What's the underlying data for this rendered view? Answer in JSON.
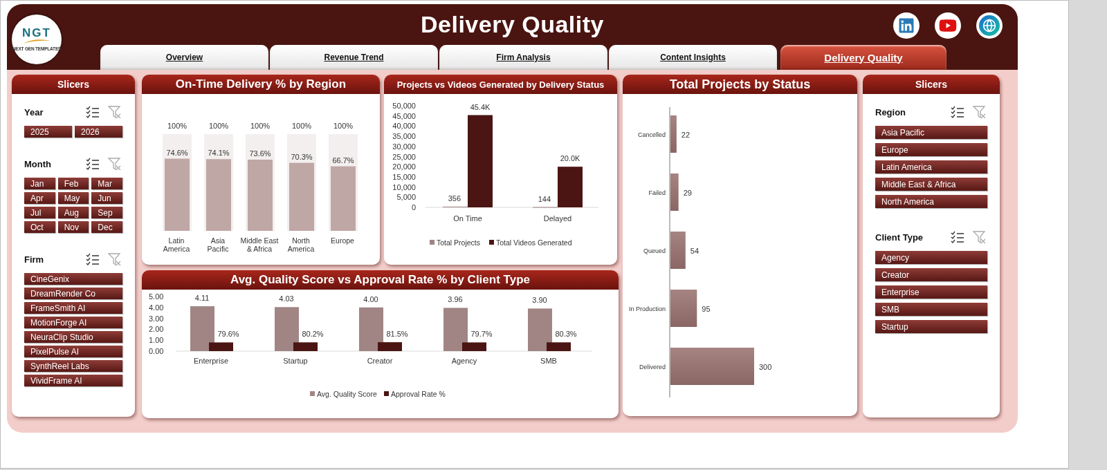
{
  "logo": {
    "text": "NGT",
    "tagline": "NEXT GEN TEMPLATES"
  },
  "title": "Delivery Quality",
  "tabs": [
    {
      "label": "Overview",
      "selected": false
    },
    {
      "label": "Revenue Trend",
      "selected": false
    },
    {
      "label": "Firm Analysis",
      "selected": false
    },
    {
      "label": "Content Insights",
      "selected": false
    },
    {
      "label": "Delivery Quality",
      "selected": true
    }
  ],
  "left_slicers": {
    "title": "Slicers",
    "groups": [
      {
        "title": "Year",
        "items": [
          {
            "label": "2025",
            "selected": true
          },
          {
            "label": "2026",
            "selected": true
          }
        ]
      },
      {
        "title": "Month",
        "items": [
          {
            "label": "Jan",
            "selected": true
          },
          {
            "label": "Feb",
            "selected": true
          },
          {
            "label": "Mar",
            "selected": true
          },
          {
            "label": "Apr",
            "selected": true
          },
          {
            "label": "May",
            "selected": true
          },
          {
            "label": "Jun",
            "selected": true
          },
          {
            "label": "Jul",
            "selected": true
          },
          {
            "label": "Aug",
            "selected": true
          },
          {
            "label": "Sep",
            "selected": true
          },
          {
            "label": "Oct",
            "selected": true
          },
          {
            "label": "Nov",
            "selected": true
          },
          {
            "label": "Dec",
            "selected": true
          }
        ]
      },
      {
        "title": "Firm",
        "items": [
          {
            "label": "CineGenix",
            "selected": true
          },
          {
            "label": "DreamRender Co",
            "selected": true
          },
          {
            "label": "FrameSmith AI",
            "selected": true
          },
          {
            "label": "MotionForge AI",
            "selected": true
          },
          {
            "label": "NeuraClip Studio",
            "selected": true
          },
          {
            "label": "PixelPulse AI",
            "selected": true
          },
          {
            "label": "SynthReel Labs",
            "selected": true
          },
          {
            "label": "VividFrame AI",
            "selected": true
          }
        ]
      }
    ]
  },
  "ontime_chart": {
    "title": "On-Time Delivery % by Region",
    "chart_data": {
      "type": "bar",
      "categories": [
        "Latin America",
        "Asia Pacific",
        "Middle East & Africa",
        "North America",
        "Europe"
      ],
      "series": [
        {
          "color": "#f3efee",
          "values": [
            100,
            100,
            100,
            100,
            100
          ],
          "value_labels": [
            "100%",
            "100%",
            "100%",
            "100%",
            "100%"
          ]
        },
        {
          "color": "#bfa7a6",
          "values": [
            74.6,
            74.1,
            73.6,
            70.3,
            66.7
          ],
          "value_labels": [
            "74.6%",
            "74.1%",
            "73.6%",
            "70.3%",
            "66.7%"
          ]
        }
      ]
    }
  },
  "videos_chart": {
    "title": "Projects vs Videos Generated by Delivery Status",
    "chart_data": {
      "type": "bar",
      "categories": [
        "On Time",
        "Delayed"
      ],
      "series": [
        {
          "name": "Total Projects",
          "color": "#a08584",
          "values": [
            356,
            144
          ],
          "value_labels": [
            "356",
            "144"
          ]
        },
        {
          "name": "Total Videos Generated",
          "color": "#4a1512",
          "values": [
            45400,
            20000
          ],
          "value_labels": [
            "45.4K",
            "20.0K"
          ]
        }
      ],
      "legend": "bottom",
      "ylim": [
        0,
        50000
      ],
      "yticks": [
        {
          "value": 0,
          "label": "0"
        },
        {
          "value": 5000,
          "label": "5,000"
        },
        {
          "value": 10000,
          "label": "10,000"
        },
        {
          "value": 15000,
          "label": "15,000"
        },
        {
          "value": 20000,
          "label": "20,000"
        },
        {
          "value": 25000,
          "label": "25,000"
        },
        {
          "value": 30000,
          "label": "30,000"
        },
        {
          "value": 35000,
          "label": "35,000"
        },
        {
          "value": 40000,
          "label": "40,000"
        },
        {
          "value": 45000,
          "label": "45,000"
        },
        {
          "value": 50000,
          "label": "50,000"
        }
      ]
    }
  },
  "quality_chart": {
    "title": "Avg. Quality Score vs Approval Rate % by Client Type",
    "chart_data": {
      "type": "bar",
      "categories": [
        "Enterprise",
        "Startup",
        "Creator",
        "Agency",
        "SMB"
      ],
      "series": [
        {
          "name": "Avg. Quality Score",
          "color": "#a08584",
          "values": [
            4.11,
            4.03,
            4.0,
            3.96,
            3.9
          ],
          "value_labels": [
            "4.11",
            "4.03",
            "4.00",
            "3.96",
            "3.90"
          ]
        },
        {
          "name": "Approval Rate %",
          "color": "#4a1512",
          "values": [
            0.796,
            0.802,
            0.815,
            0.797,
            0.803
          ],
          "value_labels": [
            "79.6%",
            "80.2%",
            "81.5%",
            "79.7%",
            "80.3%"
          ]
        }
      ],
      "legend": "bottom",
      "ylim": [
        0,
        5
      ],
      "yticks": [
        {
          "value": 0,
          "label": "0.00"
        },
        {
          "value": 1,
          "label": "1.00"
        },
        {
          "value": 2,
          "label": "2.00"
        },
        {
          "value": 3,
          "label": "3.00"
        },
        {
          "value": 4,
          "label": "4.00"
        },
        {
          "value": 5,
          "label": "5.00"
        }
      ]
    }
  },
  "status_chart": {
    "title": "Total Projects by Status",
    "chart_data": {
      "type": "bar",
      "orientation": "horizontal",
      "categories": [
        "Cancelled",
        "Failed",
        "Queued",
        "In Production",
        "Delivered"
      ],
      "series": [
        {
          "color": "#8a6664",
          "values": [
            22,
            29,
            54,
            95,
            300
          ],
          "value_labels": [
            "22",
            "29",
            "54",
            "95",
            "300"
          ]
        }
      ]
    }
  },
  "right_slicers": {
    "title": "Slicers",
    "groups": [
      {
        "title": "Region",
        "items": [
          {
            "label": "Asia Pacific",
            "selected": true
          },
          {
            "label": "Europe",
            "selected": true
          },
          {
            "label": "Latin America",
            "selected": true
          },
          {
            "label": "Middle East & Africa",
            "selected": true
          },
          {
            "label": "North America",
            "selected": true
          }
        ]
      },
      {
        "title": "Client Type",
        "items": [
          {
            "label": "Agency",
            "selected": true
          },
          {
            "label": "Creator",
            "selected": true
          },
          {
            "label": "Enterprise",
            "selected": true
          },
          {
            "label": "SMB",
            "selected": true
          },
          {
            "label": "Startup",
            "selected": true
          }
        ]
      }
    ]
  }
}
